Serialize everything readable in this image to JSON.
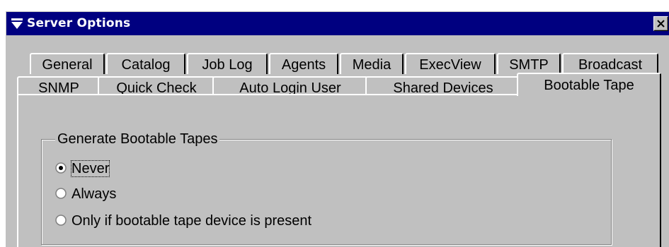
{
  "window": {
    "title": "Server Options",
    "title_icon": "funnel-icon",
    "close_icon": "close-icon"
  },
  "tabs": {
    "row1": [
      "General",
      "Catalog",
      "Job Log",
      "Agents",
      "Media",
      "ExecView",
      "SMTP",
      "Broadcast"
    ],
    "row2": [
      "SNMP",
      "Quick Check",
      "Auto Login User",
      "Shared Devices",
      "Bootable Tape"
    ],
    "active": "Bootable Tape"
  },
  "group": {
    "title": "Generate Bootable Tapes",
    "options": [
      {
        "label": "Never",
        "selected": true
      },
      {
        "label": "Always",
        "selected": false
      },
      {
        "label": "Only if bootable tape device is present",
        "selected": false
      }
    ]
  },
  "colors": {
    "titlebar": "#000080",
    "face": "#c0c0c0",
    "highlight": "#ffffff",
    "shadow": "#808080"
  }
}
